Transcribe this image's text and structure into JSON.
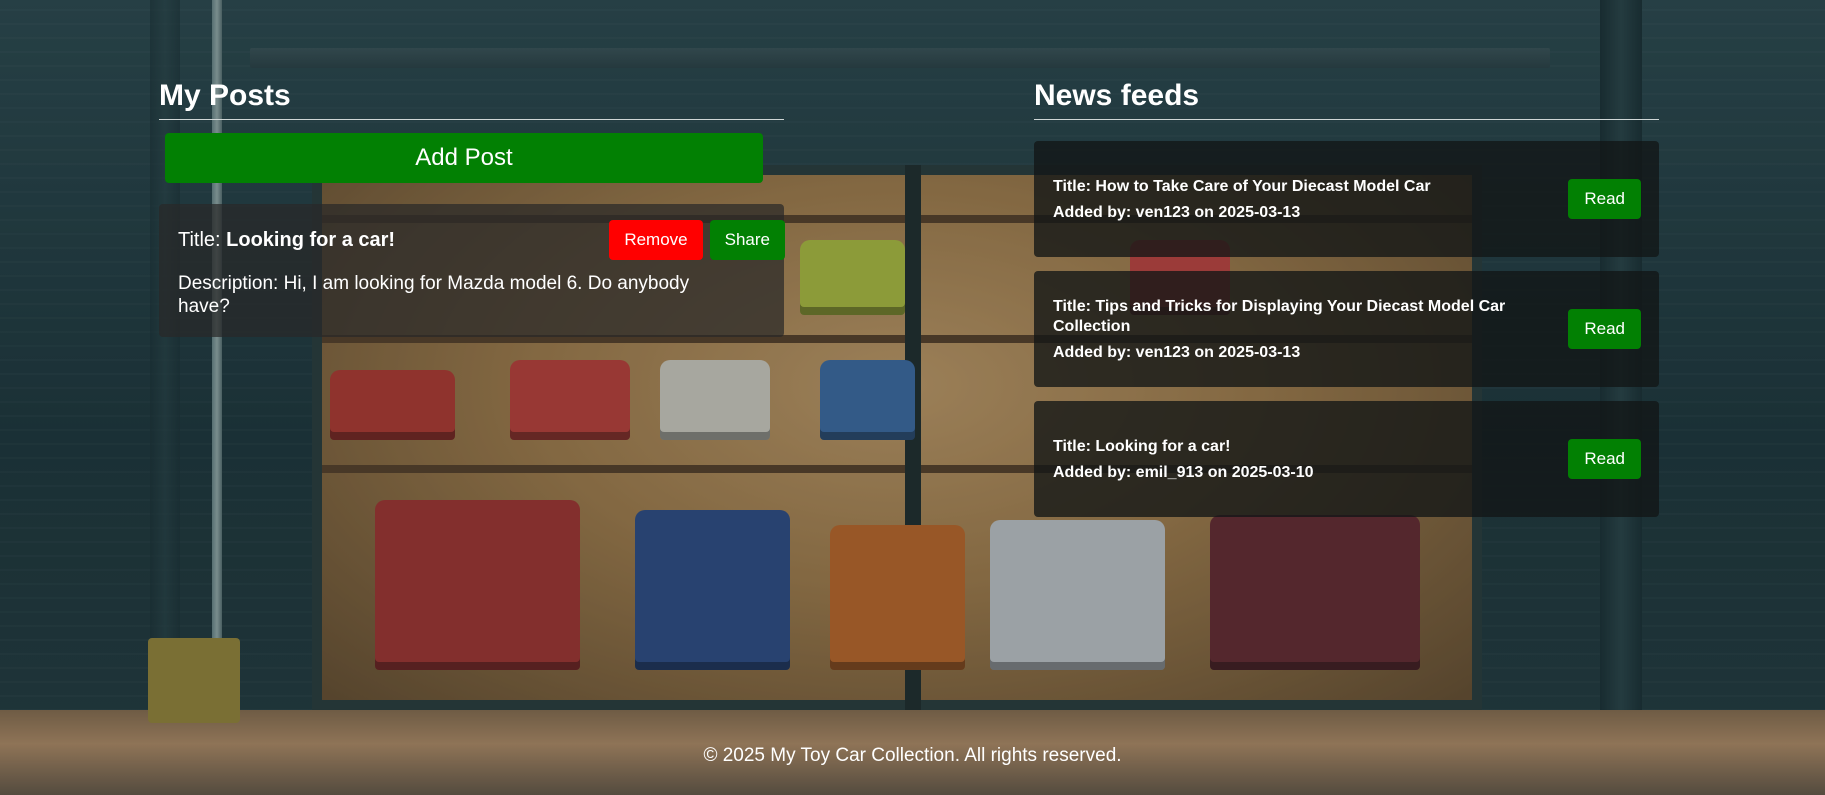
{
  "my_posts": {
    "heading": "My Posts",
    "add_post_label": "Add Post",
    "posts": [
      {
        "title_prefix": "Title: ",
        "title": "Looking for a car!",
        "remove_label": "Remove",
        "share_label": "Share",
        "description": "Description: Hi, I am looking for Mazda model 6. Do anybody have?"
      }
    ]
  },
  "news_feeds": {
    "heading": "News feeds",
    "items": [
      {
        "title": "Title: How to Take Care of Your Diecast Model Car",
        "meta": "Added by: ven123 on 2025-03-13",
        "read_label": "Read"
      },
      {
        "title": "Title: Tips and Tricks for Displaying Your Diecast Model Car Collection",
        "meta": "Added by: ven123 on 2025-03-13",
        "read_label": "Read"
      },
      {
        "title": "Title: Looking for a car!",
        "meta": "Added by: emil_913 on 2025-03-10",
        "read_label": "Read"
      }
    ]
  },
  "footer": {
    "text": "© 2025 My Toy Car Collection. All rights reserved."
  },
  "colors": {
    "primary_green": "#028003",
    "danger_red": "#ff0000",
    "text": "#ffffff"
  }
}
